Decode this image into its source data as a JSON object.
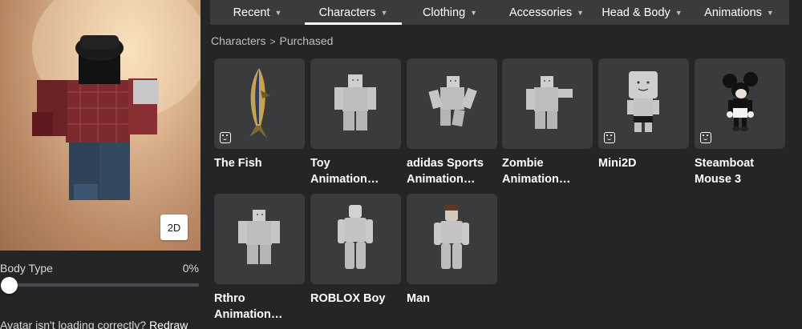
{
  "tabs": [
    {
      "label": "Recent",
      "active": false
    },
    {
      "label": "Characters",
      "active": true
    },
    {
      "label": "Clothing",
      "active": false
    },
    {
      "label": "Accessories",
      "active": false
    },
    {
      "label": "Head & Body",
      "active": false
    },
    {
      "label": "Animations",
      "active": false
    }
  ],
  "breadcrumb": {
    "root": "Characters",
    "separator": ">",
    "current": "Purchased"
  },
  "avatar": {
    "toggle_2d_label": "2D",
    "body_type_label": "Body Type",
    "body_type_value": "0%",
    "body_type_fraction": 0,
    "error_text": "Avatar isn't loading correctly?",
    "redraw_label": "Redraw"
  },
  "items": [
    {
      "name": "The Fish",
      "line1": "The Fish",
      "line2": "",
      "badge": true,
      "thumb": "fish-thumbnail"
    },
    {
      "name": "Toy Animation…",
      "line1": "Toy",
      "line2": "Animation…",
      "badge": false,
      "thumb": "blocky-figure-thumbnail"
    },
    {
      "name": "adidas Sports Animation…",
      "line1": "adidas Sports",
      "line2": "Animation…",
      "badge": false,
      "thumb": "blocky-figure-thumbnail"
    },
    {
      "name": "Zombie Animation…",
      "line1": "Zombie",
      "line2": "Animation…",
      "badge": false,
      "thumb": "blocky-figure-thumbnail"
    },
    {
      "name": "Mini2D",
      "line1": "Mini2D",
      "line2": "",
      "badge": true,
      "thumb": "mini-figure-thumbnail"
    },
    {
      "name": "Steamboat Mouse 3",
      "line1": "Steamboat",
      "line2": "Mouse 3",
      "badge": true,
      "thumb": "mouse-thumbnail"
    },
    {
      "name": "Rthro Animation…",
      "line1": "Rthro",
      "line2": "Animation…",
      "badge": false,
      "thumb": "blocky-figure-thumbnail"
    },
    {
      "name": "ROBLOX Boy",
      "line1": "ROBLOX Boy",
      "line2": "",
      "badge": false,
      "thumb": "boy-figure-thumbnail"
    },
    {
      "name": "Man",
      "line1": "Man",
      "line2": "",
      "badge": false,
      "thumb": "man-figure-thumbnail"
    }
  ],
  "colors": {
    "background": "#232527",
    "card": "#393b3d",
    "tabbar": "#393b3d",
    "text": "#ffffff",
    "muted": "#bdbebe"
  }
}
